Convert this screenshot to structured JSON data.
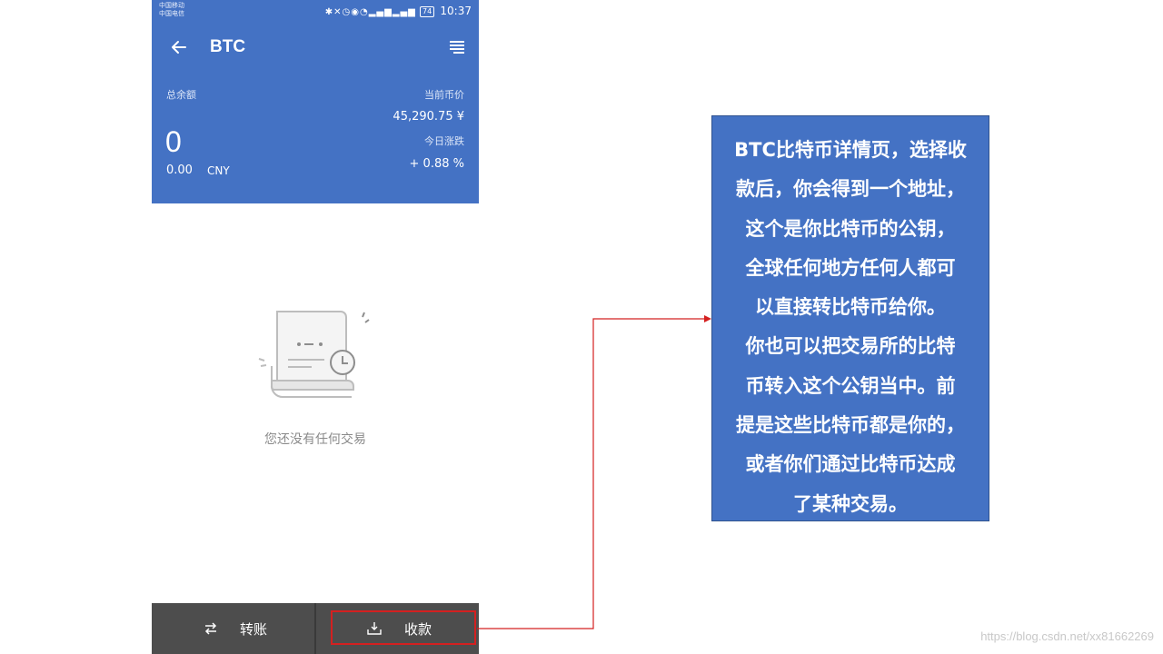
{
  "status_bar": {
    "carrier_1": "中国移动",
    "carrier_2": "中国电信",
    "battery": "74",
    "time": "10:37"
  },
  "header": {
    "title": "BTC",
    "back_icon": "arrow-left-icon",
    "menu_icon": "list-icon",
    "total_balance_label": "总余额",
    "balance": "0",
    "balance_cny": "0.00",
    "currency": "CNY",
    "current_price_label": "当前币价",
    "current_price": "45,290.75 ¥",
    "daily_change_label": "今日涨跌",
    "daily_change": "+ 0.88 %"
  },
  "empty_state": {
    "icon": "empty-receipt-icon",
    "text": "您还没有任何交易"
  },
  "bottom_bar": {
    "transfer_label": "转账",
    "transfer_icon": "swap-arrows-icon",
    "receive_label": "收款",
    "receive_icon": "receive-tray-icon"
  },
  "annotation": {
    "lines": [
      "BTC比特币详情页，选择收",
      "款后，你会得到一个地址，",
      "这个是你比特币的公钥，",
      "全球任何地方任何人都可",
      "以直接转比特币给你。",
      "你也可以把交易所的比特",
      "币转入这个公钥当中。前",
      "提是这些比特币都是你的，",
      "或者你们通过比特币达成",
      "了某种交易。"
    ]
  },
  "colors": {
    "header_bg": "#4472c4",
    "note_bg": "#4472c4",
    "bottom_bar_bg": "#4d4d4d",
    "highlight": "#d42020"
  },
  "watermark": "https://blog.csdn.net/xx81662269"
}
